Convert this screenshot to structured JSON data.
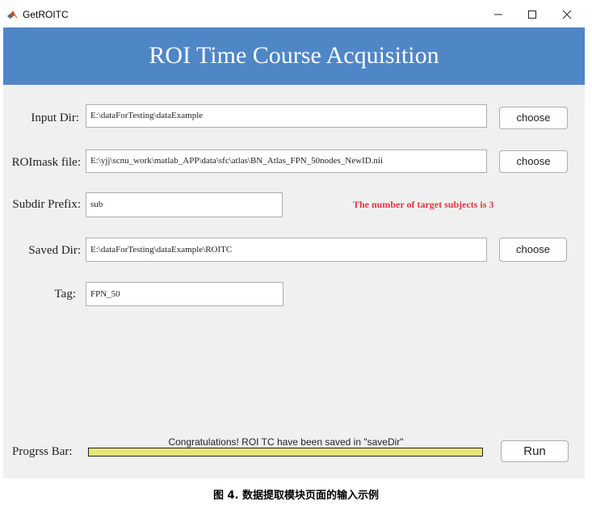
{
  "window": {
    "title": "GetROITC"
  },
  "header": {
    "title": "ROI Time Course Acquisition"
  },
  "form": {
    "input_dir": {
      "label": "Input Dir:",
      "value": "E:\\dataForTesting\\dataExample",
      "button": "choose"
    },
    "roimask_file": {
      "label": "ROImask file:",
      "value": "E:\\yjj\\scnu_work\\matlab_APP\\data\\sfc\\atlas\\BN_Atlas_FPN_50nodes_NewID.nii",
      "button": "choose"
    },
    "subdir_prefix": {
      "label": "Subdir Prefix:",
      "value": "sub"
    },
    "saved_dir": {
      "label": "Saved Dir:",
      "value": "E:\\dataForTesting\\dataExample\\ROITC",
      "button": "choose"
    },
    "tag": {
      "label": "Tag:",
      "value": "FPN_50"
    }
  },
  "status": {
    "message": "The number of target subjects is 3",
    "color": "#e8343a"
  },
  "progress": {
    "label": "Progrss Bar:",
    "message": "Congratulations! ROI TC have been saved in \"saveDir\"",
    "fraction": 1.0,
    "fill_color": "#e6e67a"
  },
  "run_button": "Run",
  "caption": "图 4. 数据提取模块页面的输入示例",
  "colors": {
    "header": "#4f86c6",
    "panel": "#f0f0f0"
  },
  "icons": [
    "matlab-app-icon",
    "minimize-icon",
    "maximize-icon",
    "close-icon"
  ]
}
